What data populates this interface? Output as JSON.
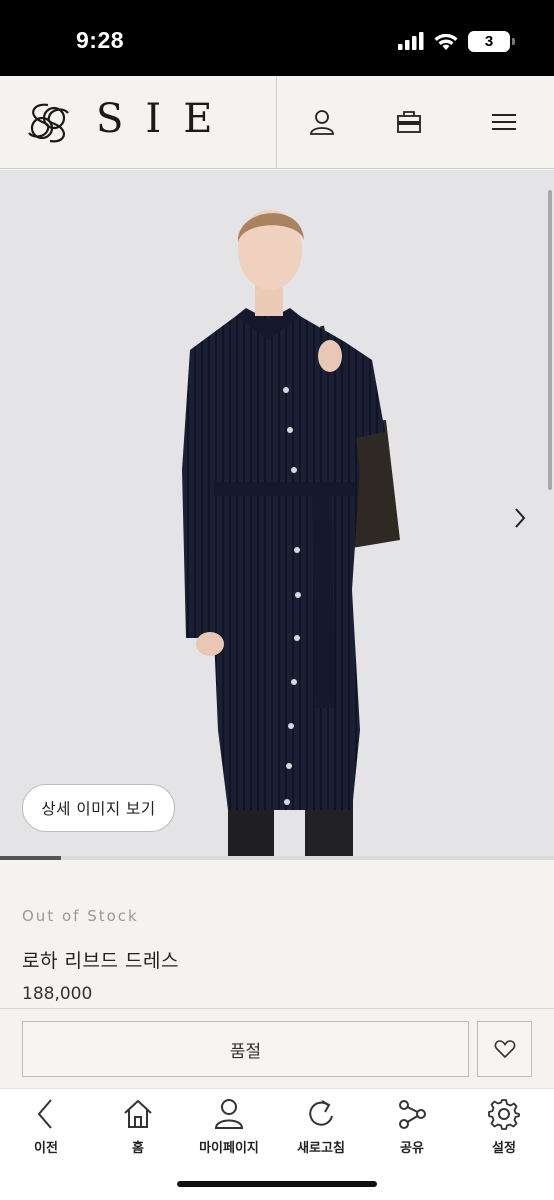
{
  "status_bar": {
    "time": "9:28",
    "battery": "3"
  },
  "brand": {
    "logo_text": "SIE"
  },
  "icons": {
    "account": "user-icon",
    "shop": "shopping-bag-icon",
    "menu": "hamburger-menu-icon",
    "next": "chevron-right-icon",
    "wish": "heart-icon"
  },
  "hero": {
    "detail_button": "상세 이미지 보기",
    "slide_progress": 0.11
  },
  "product": {
    "stock": "Out of Stock",
    "name": "로하 리브드 드레스",
    "price": "188,000",
    "soldout_button": "품절"
  },
  "toolbar": {
    "items": [
      {
        "label": "이전",
        "icon": "back-arrow-icon"
      },
      {
        "label": "홈",
        "icon": "home-icon"
      },
      {
        "label": "마이페이지",
        "icon": "user-icon"
      },
      {
        "label": "새로고침",
        "icon": "refresh-icon"
      },
      {
        "label": "공유",
        "icon": "share-icon"
      },
      {
        "label": "설정",
        "icon": "gear-icon"
      }
    ]
  }
}
